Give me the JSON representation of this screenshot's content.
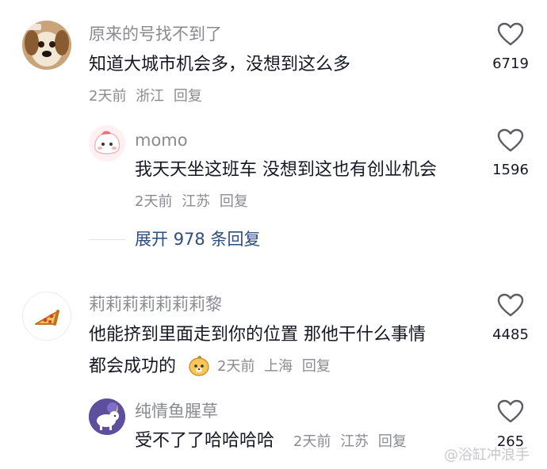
{
  "comments": [
    {
      "username": "原来的号找不到了",
      "text": "知道大城市机会多，没想到这么多",
      "time": "2天前",
      "location": "浙江",
      "reply_label": "回复",
      "likes": "6719",
      "avatar": "dog-avatar-icon"
    },
    {
      "username": "momo",
      "text": "我天天坐这班车 没想到这也有创业机会",
      "time": "2天前",
      "location": "江苏",
      "reply_label": "回复",
      "likes": "1596",
      "avatar": "pink-blob-avatar-icon"
    },
    {
      "username": "莉莉莉莉莉莉莉黎",
      "text_line1": "他能挤到里面走到你的位置 那他干什么事情",
      "text_line2": "都会成功的",
      "time": "2天前",
      "location": "上海",
      "reply_label": "回复",
      "likes": "4485",
      "avatar": "pizza-avatar-icon"
    },
    {
      "username": "纯情鱼腥草",
      "text": "受不了了哈哈哈哈",
      "time": "2天前",
      "location": "江苏",
      "reply_label": "回复",
      "likes": "265",
      "avatar": "unicorn-avatar-icon"
    }
  ],
  "expand_replies": {
    "prefix": "展开",
    "count": "978",
    "suffix": "条回复"
  },
  "watermark": "@浴缸冲浪手",
  "colors": {
    "username": "#8a8b91",
    "content": "#161823",
    "link": "#2d4d7e",
    "divider": "#e3e3e6"
  }
}
